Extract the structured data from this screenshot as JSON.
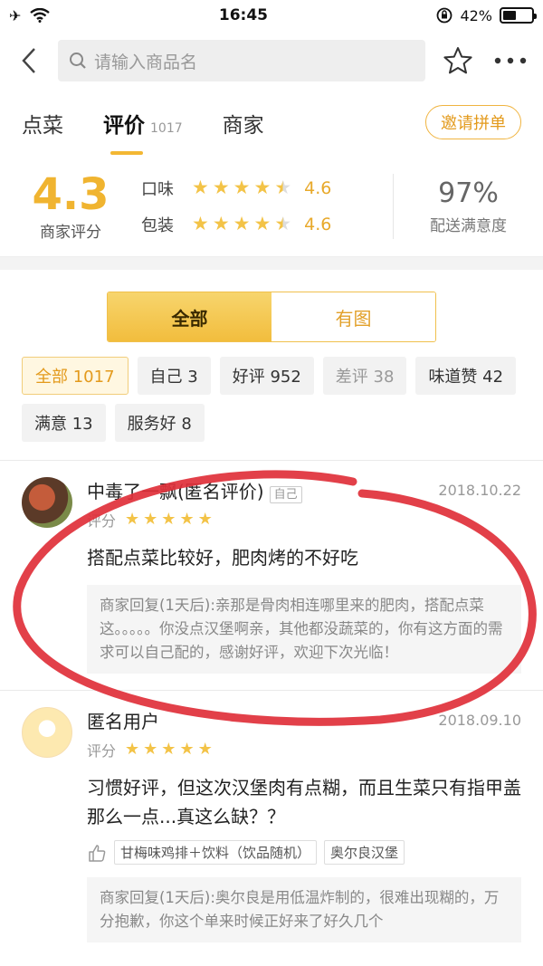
{
  "status": {
    "time": "16:45",
    "battery": "42%"
  },
  "search": {
    "placeholder": "请输入商品名"
  },
  "tabs": [
    {
      "label": "点菜"
    },
    {
      "label": "评价",
      "count": "1017"
    },
    {
      "label": "商家"
    }
  ],
  "invite_label": "邀请拼单",
  "summary": {
    "score": "4.3",
    "score_label": "商家评分",
    "rows": [
      {
        "name": "口味",
        "value": "4.6",
        "stars": 4.5
      },
      {
        "name": "包装",
        "value": "4.6",
        "stars": 4.5
      }
    ],
    "satisfaction": "97%",
    "satisfaction_label": "配送满意度"
  },
  "segment": {
    "all": "全部",
    "with_image": "有图"
  },
  "chips": [
    {
      "label": "全部 1017",
      "state": "selected"
    },
    {
      "label": "自己 3",
      "state": "normal"
    },
    {
      "label": "好评 952",
      "state": "normal"
    },
    {
      "label": "差评 38",
      "state": "dim"
    },
    {
      "label": "味道赞 42",
      "state": "normal"
    },
    {
      "label": "满意 13",
      "state": "normal"
    },
    {
      "label": "服务好 8",
      "state": "normal"
    }
  ],
  "reviews": [
    {
      "user": "中毒了一飘(匿名评价)",
      "self_tag": "自己",
      "date": "2018.10.22",
      "rating_label": "评分",
      "stars": 5,
      "comment": "搭配点菜比较好，肥肉烤的不好吃",
      "reply": "商家回复(1天后):亲那是骨肉相连哪里来的肥肉，搭配点菜这。。。。。你没点汉堡啊亲，其他都没蔬菜的，你有这方面的需求可以自己配的，感谢好评，欢迎下次光临！"
    },
    {
      "user": "匿名用户",
      "date": "2018.09.10",
      "rating_label": "评分",
      "stars": 5,
      "comment": "习惯好评，但这次汉堡肉有点糊，而且生菜只有指甲盖那么一点...真这么缺？？",
      "tags": [
        "甘梅味鸡排＋饮料（饮品随机）",
        "奥尔良汉堡"
      ],
      "reply": "商家回复(1天后):奥尔良是用低温炸制的，很难出现糊的，万分抱歉，你这个单来时候正好来了好久几个"
    }
  ],
  "colors": {
    "accent": "#f3b733",
    "annotation": "#e0303a"
  }
}
